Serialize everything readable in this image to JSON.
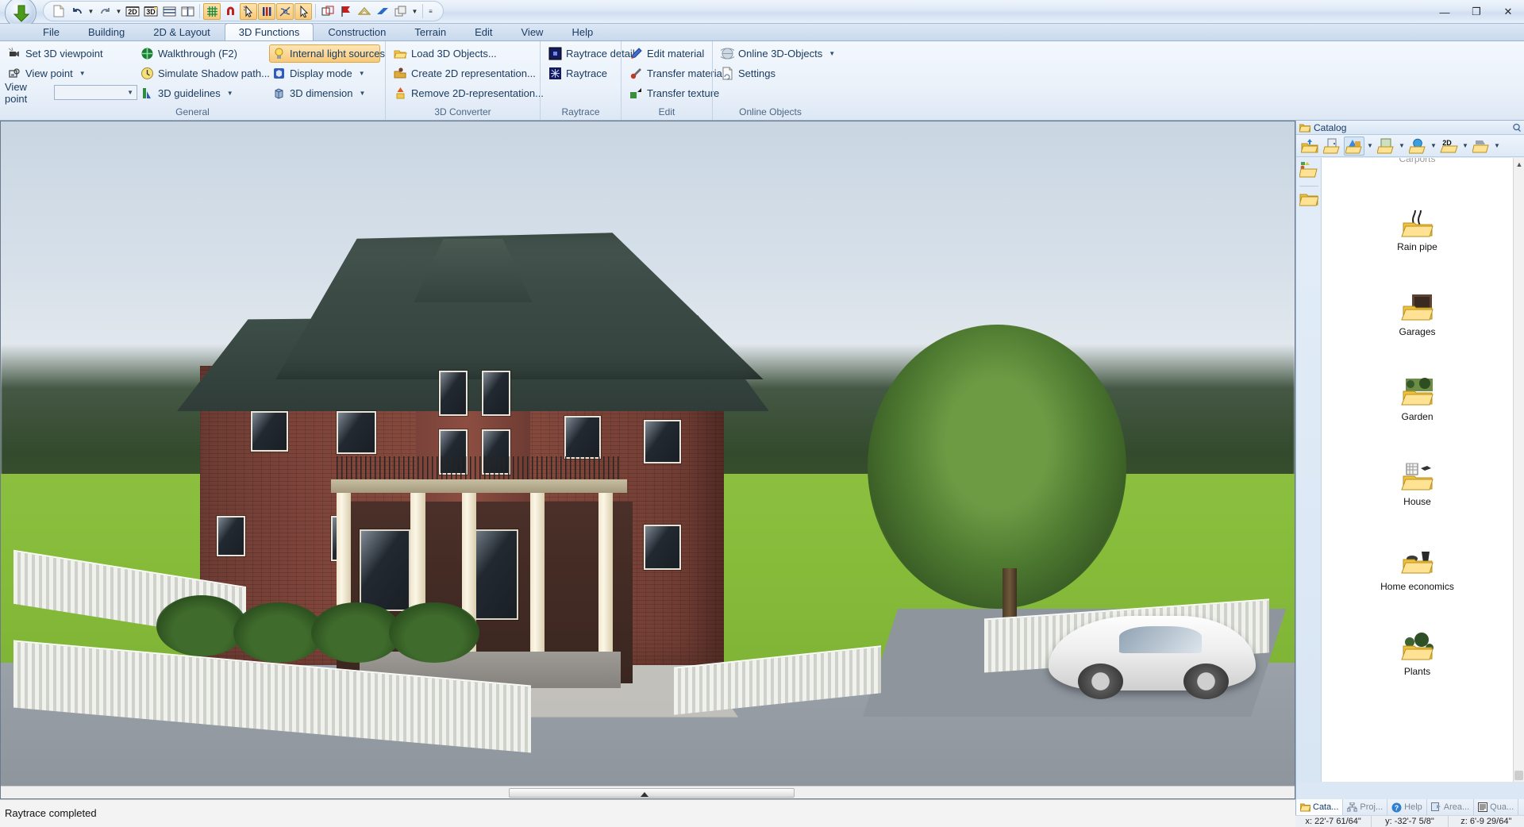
{
  "window": {
    "app_icon": "down-arrow-app-icon",
    "minimize": "—",
    "maximize": "❐",
    "close": "✕",
    "inner_minimize": "_",
    "inner_maximize": "❐",
    "inner_close": "✕"
  },
  "quick_access": {
    "items": [
      {
        "name": "new-document-icon",
        "glyph": "▯"
      },
      {
        "name": "undo-icon",
        "glyph": "↺",
        "has_caret": true
      },
      {
        "name": "redo-icon",
        "glyph": "↻",
        "has_caret": true
      },
      {
        "name": "view-2d-icon",
        "glyph": "2D"
      },
      {
        "name": "view-3d-icon",
        "glyph": "3D"
      },
      {
        "name": "split-horizontal-icon",
        "glyph": "▤"
      },
      {
        "name": "split-vertical-icon",
        "glyph": "▥"
      },
      {
        "name": "grid-icon",
        "glyph": "▦",
        "active": true
      },
      {
        "name": "magnet-snap-icon",
        "glyph": "Ɔ",
        "active": false
      },
      {
        "name": "select-pointer-icon",
        "glyph": "↖",
        "active": true
      },
      {
        "name": "walls-icon",
        "glyph": "|||",
        "active": true
      },
      {
        "name": "dimension-icon",
        "glyph": "✳",
        "active": true
      },
      {
        "name": "arrow-select-icon",
        "glyph": "➤",
        "active": true
      },
      {
        "name": "object-copy-icon",
        "glyph": "❏"
      },
      {
        "name": "flag-icon",
        "glyph": "⚑"
      },
      {
        "name": "roof-icon",
        "glyph": "⌂"
      },
      {
        "name": "slab-icon",
        "glyph": "◤"
      },
      {
        "name": "layers-icon",
        "glyph": "❐",
        "has_caret": true
      },
      {
        "name": "overflow-icon",
        "glyph": "≡"
      }
    ]
  },
  "ribbon": {
    "tabs": [
      {
        "label": "File",
        "active": false
      },
      {
        "label": "Building",
        "active": false
      },
      {
        "label": "2D & Layout",
        "active": false
      },
      {
        "label": "3D Functions",
        "active": true
      },
      {
        "label": "Construction",
        "active": false
      },
      {
        "label": "Terrain",
        "active": false
      },
      {
        "label": "Edit",
        "active": false
      },
      {
        "label": "View",
        "active": false
      },
      {
        "label": "Help",
        "active": false
      }
    ],
    "groups": [
      {
        "label": "General",
        "columns": [
          {
            "items": [
              {
                "label": "Set 3D viewpoint",
                "icon": "camera-icon",
                "caret": false,
                "active": false
              },
              {
                "label": "View point",
                "icon": "viewpoint-icon",
                "caret": true,
                "active": false
              }
            ],
            "field": {
              "label": "View point",
              "value": "",
              "placeholder": ""
            }
          },
          {
            "items": [
              {
                "label": "Walkthrough (F2)",
                "icon": "walkthrough-icon",
                "caret": false,
                "active": false
              },
              {
                "label": "Simulate Shadow path...",
                "icon": "shadow-clock-icon",
                "caret": false,
                "active": false
              },
              {
                "label": "3D guidelines",
                "icon": "guidelines-icon",
                "caret": true,
                "active": false
              }
            ]
          },
          {
            "items": [
              {
                "label": "Internal light sources",
                "icon": "lightbulb-icon",
                "caret": false,
                "active": true
              },
              {
                "label": "Display mode",
                "icon": "cube-display-icon",
                "caret": true,
                "active": false
              },
              {
                "label": "3D dimension",
                "icon": "cube-dimension-icon",
                "caret": true,
                "active": false
              }
            ]
          }
        ]
      },
      {
        "label": "3D Converter",
        "columns": [
          {
            "items": [
              {
                "label": "Load 3D Objects...",
                "icon": "folder-open-icon",
                "caret": false,
                "active": false
              },
              {
                "label": "Create 2D representation...",
                "icon": "create-2d-icon",
                "caret": false,
                "active": false
              },
              {
                "label": "Remove 2D-representation...",
                "icon": "remove-2d-icon",
                "caret": false,
                "active": false
              }
            ]
          }
        ]
      },
      {
        "label": "Raytrace",
        "columns": [
          {
            "items": [
              {
                "label": "Raytrace detail",
                "icon": "raytrace-detail-icon",
                "caret": false,
                "active": false
              },
              {
                "label": "Raytrace",
                "icon": "raytrace-icon",
                "caret": false,
                "active": false
              }
            ]
          }
        ]
      },
      {
        "label": "Edit",
        "columns": [
          {
            "items": [
              {
                "label": "Edit material",
                "icon": "edit-material-icon",
                "caret": false,
                "active": false
              },
              {
                "label": "Transfer material",
                "icon": "transfer-material-icon",
                "caret": false,
                "active": false
              },
              {
                "label": "Transfer texture",
                "icon": "transfer-texture-icon",
                "caret": false,
                "active": false
              }
            ]
          }
        ]
      },
      {
        "label": "Online Objects",
        "columns": [
          {
            "items": [
              {
                "label": "Online 3D-Objects",
                "icon": "globe-icon",
                "caret": true,
                "active": false
              },
              {
                "label": "Settings",
                "icon": "settings-page-icon",
                "caret": false,
                "active": false
              }
            ]
          }
        ]
      }
    ]
  },
  "catalog": {
    "title": "Catalog",
    "title_icon": "catalog-folder-icon",
    "restore_icon": "restore-panel-icon",
    "toolbar": [
      {
        "name": "catalog-up-folder-icon",
        "caret": false,
        "selected": false
      },
      {
        "name": "catalog-doors-icon",
        "caret": false,
        "selected": false
      },
      {
        "name": "catalog-3d-objects-icon",
        "caret": true,
        "selected": true
      },
      {
        "name": "catalog-textures-icon",
        "caret": true,
        "selected": false
      },
      {
        "name": "catalog-materials-icon",
        "caret": true,
        "selected": false
      },
      {
        "name": "catalog-2d-icon",
        "caret": true,
        "selected": false,
        "glyph": "2D"
      },
      {
        "name": "catalog-misc-icon",
        "caret": true,
        "selected": false
      }
    ],
    "side_buttons": [
      {
        "name": "catalog-tree-icon"
      },
      {
        "name": "catalog-favorites-icon"
      }
    ],
    "scrolled_top_item": "Carports",
    "items": [
      {
        "label": "Rain pipe",
        "icon": "rain-pipe-folder-icon"
      },
      {
        "label": "Garages",
        "icon": "garages-folder-icon"
      },
      {
        "label": "Garden",
        "icon": "garden-folder-icon"
      },
      {
        "label": "House",
        "icon": "house-folder-icon"
      },
      {
        "label": "Home economics",
        "icon": "home-economics-folder-icon"
      },
      {
        "label": "Plants",
        "icon": "plants-folder-icon"
      }
    ]
  },
  "statusbar": {
    "message": "Raytrace completed",
    "tabs": [
      {
        "label": "Cata...",
        "icon": "catalog-tab-icon",
        "active": true
      },
      {
        "label": "Proj...",
        "icon": "project-tab-icon",
        "active": false
      },
      {
        "label": "Help",
        "icon": "help-tab-icon",
        "active": false
      },
      {
        "label": "Area...",
        "icon": "area-tab-icon",
        "active": false
      },
      {
        "label": "Qua...",
        "icon": "quantity-tab-icon",
        "active": false
      }
    ],
    "coords": [
      "x: 22'-7 61/64\"",
      "y: -32'-7 5/8\"",
      "z: 6'-9 29/64\""
    ]
  },
  "colors": {
    "accent": "#f7c97a",
    "ribbon_text": "#1b3c60",
    "tab_active_bg": "#fbfdff",
    "lawn": "#86bb3a",
    "brick": "#8b4c40",
    "roof": "#33423d"
  }
}
